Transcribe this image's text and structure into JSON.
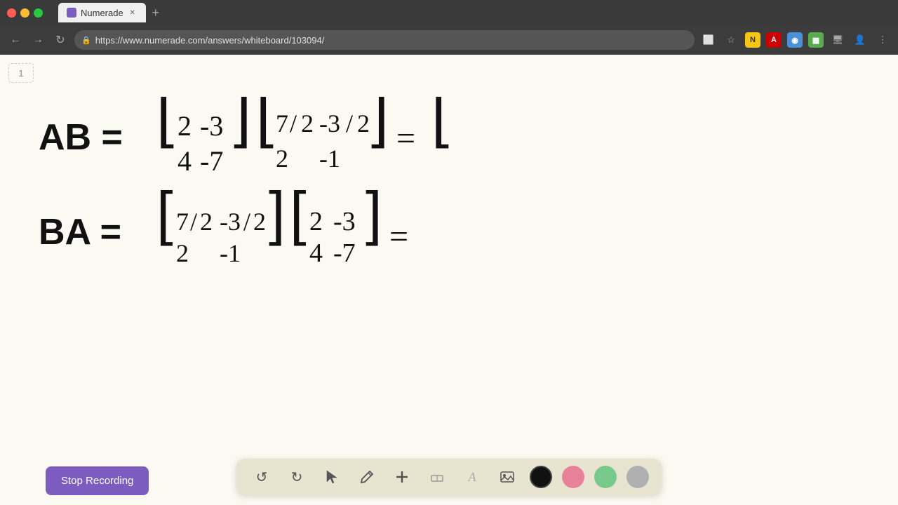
{
  "browser": {
    "tab_title": "Numerade",
    "url": "https://www.numerade.com/answers/whiteboard/103094/",
    "new_tab_label": "+"
  },
  "toolbar": {
    "undo_label": "↺",
    "redo_label": "↻",
    "select_label": "▲",
    "pen_label": "✏",
    "plus_label": "+",
    "eraser_label": "▭",
    "text_label": "A",
    "image_label": "🖼",
    "colors": [
      "#111111",
      "#e8829a",
      "#7ac98c",
      "#b0b0b0"
    ]
  },
  "stop_recording": {
    "label": "Stop Recording"
  },
  "page_number": "1",
  "equation_line1": "AB = [ 2  -3 ] [ 7/2  -3/2 ] = [",
  "equation_line2": "     [ 4  -7 ] [  2   -1  ]",
  "equation_line3": "BA = [ 7/2  -3/2 ] [ 2  -3 ] =",
  "equation_line4": "     [  2   -1  ] [ 4  -7 ]"
}
